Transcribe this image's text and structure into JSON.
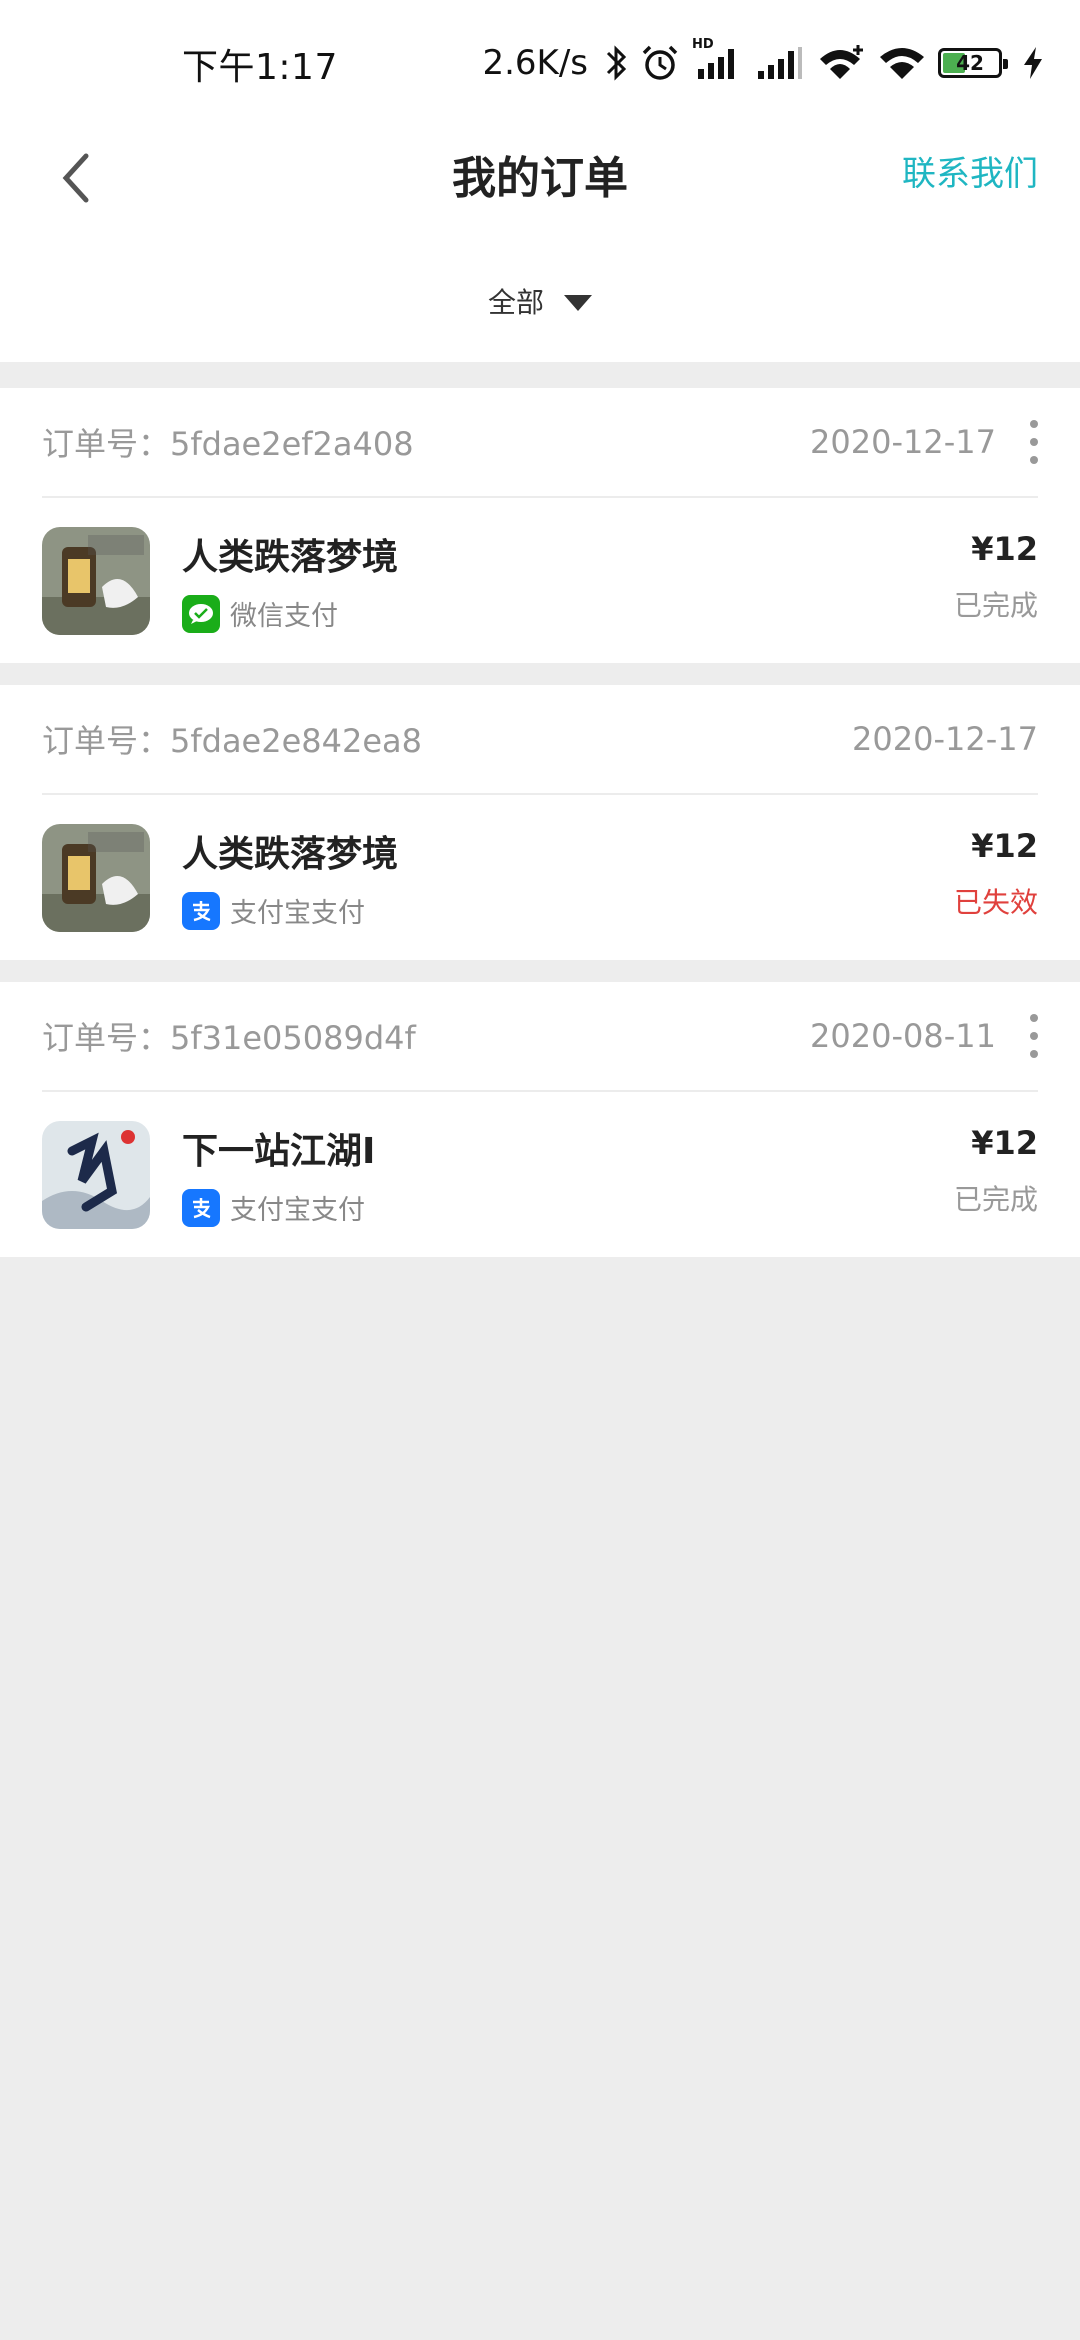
{
  "statusbar": {
    "time": "下午1:17",
    "net_speed": "2.6K/s",
    "hd_label": "HD",
    "battery": "42",
    "icons": [
      "bluetooth-icon",
      "alarm-icon",
      "signal-hd-icon",
      "signal-icon",
      "wifi-plus-icon",
      "wifi-icon",
      "battery-icon",
      "charging-icon"
    ]
  },
  "header": {
    "back_icon": "chevron-left-icon",
    "title": "我的订单",
    "contact": "联系我们"
  },
  "filter": {
    "label": "全部",
    "icon": "caret-down-icon"
  },
  "orders": [
    {
      "order_no": "订单号：5fdae2ef2a408",
      "date": "2020-12-17",
      "game": "人类跌落梦境",
      "pay_method": "微信支付",
      "pay_icon": "wechat-pay-icon",
      "price": "¥12",
      "status": "已完成",
      "has_more": true
    },
    {
      "order_no": "订单号：5fdae2e842ea8",
      "date": "2020-12-17",
      "game": "人类跌落梦境",
      "pay_method": "支付宝支付",
      "pay_icon": "alipay-icon",
      "price": "¥12",
      "status": "已失效",
      "has_more": false
    },
    {
      "order_no": "订单号：5f31e05089d4f",
      "date": "2020-08-11",
      "game": "下一站江湖Ⅰ",
      "pay_method": "支付宝支付",
      "pay_icon": "alipay-icon",
      "price": "¥12",
      "status": "已完成",
      "has_more": true
    }
  ],
  "colors": {
    "accent": "#1fb6c2",
    "failed": "#e0413d",
    "wechat": "#1aad19",
    "alipay": "#1677ff"
  }
}
